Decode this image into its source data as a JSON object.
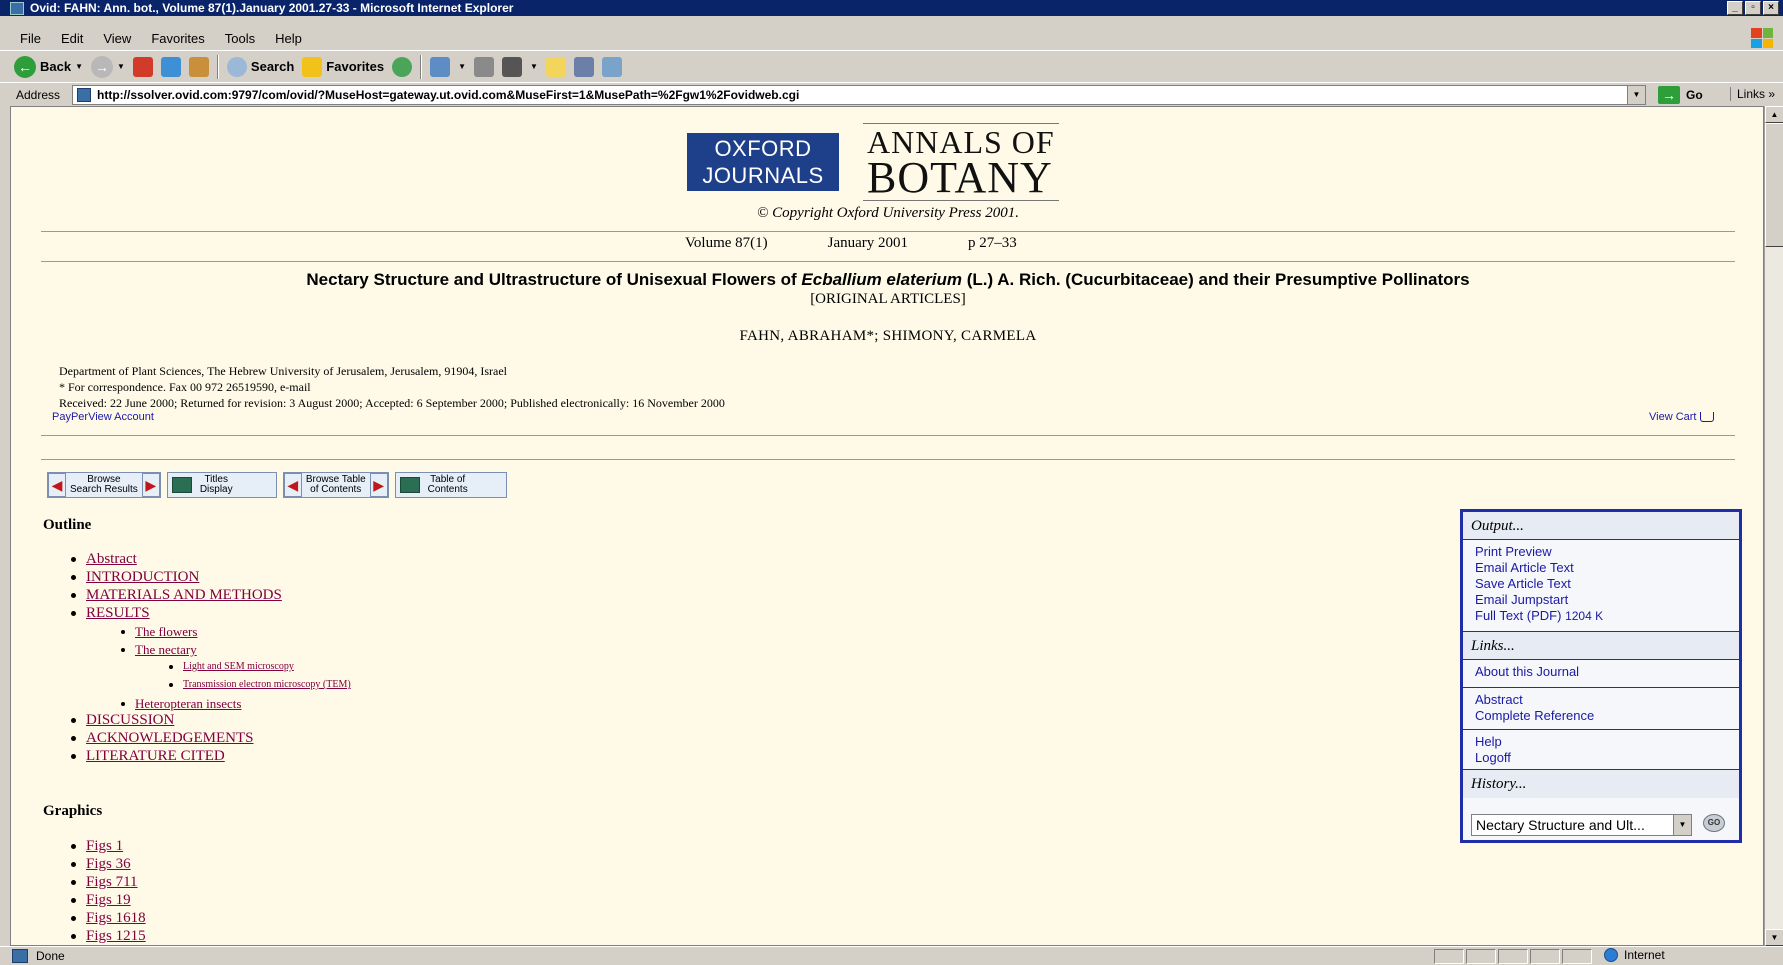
{
  "window": {
    "title": "Ovid: FAHN: Ann. bot., Volume 87(1).January 2001.27-33 - Microsoft Internet Explorer",
    "controls": [
      "_",
      "▫",
      "×"
    ]
  },
  "menu": {
    "items": [
      "File",
      "Edit",
      "View",
      "Favorites",
      "Tools",
      "Help"
    ]
  },
  "toolbar": {
    "back_label": "Back",
    "search_label": "Search",
    "favorites_label": "Favorites"
  },
  "address": {
    "label": "Address",
    "url": "http://ssolver.ovid.com:9797/com/ovid/?MuseHost=gateway.ut.ovid.com&MuseFirst=1&MusePath=%2Fgw1%2Fovidweb.cgi",
    "go_label": "Go",
    "links_label": "Links"
  },
  "masthead": {
    "oxford_line1": "OXFORD",
    "oxford_line2": "JOURNALS",
    "annals_line1": "ANNALS OF",
    "annals_line2": "BOTANY",
    "copyright": "© Copyright Oxford University Press 2001."
  },
  "citation": {
    "volume": "Volume 87(1)",
    "date": "January 2001",
    "pages": "p 27–33"
  },
  "article": {
    "title_part1": "Nectary Structure and Ultrastructure of Unisexual Flowers of ",
    "title_italic": "Ecballium elaterium",
    "title_part2": " (L.) A. Rich. (Cucurbitaceae) and their Presumptive Pollinators",
    "type": "[ORIGINAL ARTICLES]",
    "authors": "FAHN, ABRAHAM*; SHIMONY, CARMELA",
    "affiliation": "Department of Plant Sciences, The Hebrew University of Jerusalem, Jerusalem, 91904, Israel",
    "correspondence": "* For correspondence. Fax 00 972 26519590, e-mail",
    "dates": "Received: 22 June 2000; Returned for revision: 3 August 2000; Accepted: 6 September 2000; Published electronically: 16 November 2000"
  },
  "links_row": {
    "ppv": "PayPerView Account",
    "view_cart": "View Cart"
  },
  "nav_buttons": {
    "browse_results_l1": "Browse",
    "browse_results_l2": "Search Results",
    "titles_l1": "Titles",
    "titles_l2": "Display",
    "browse_toc_l1": "Browse Table",
    "browse_toc_l2": "of Contents",
    "toc_l1": "Table of",
    "toc_l2": "Contents"
  },
  "outline": {
    "heading": "Outline",
    "items": [
      {
        "label": "Abstract",
        "level": 1
      },
      {
        "label": "INTRODUCTION",
        "level": 1
      },
      {
        "label": "MATERIALS AND METHODS",
        "level": 1
      },
      {
        "label": "RESULTS",
        "level": 1
      },
      {
        "label": "The flowers",
        "level": 2
      },
      {
        "label": "The nectary",
        "level": 2
      },
      {
        "label": "Light and SEM microscopy",
        "level": 3
      },
      {
        "label": "Transmission electron microscopy (TEM)",
        "level": 3
      },
      {
        "label": "Heteropteran insects",
        "level": 2
      },
      {
        "label": "DISCUSSION",
        "level": 1
      },
      {
        "label": "ACKNOWLEDGEMENTS",
        "level": 1
      },
      {
        "label": "LITERATURE CITED",
        "level": 1
      }
    ]
  },
  "graphics": {
    "heading": "Graphics",
    "items": [
      "Figs 1",
      "Figs 36",
      "Figs 711",
      "Figs 19",
      "Figs 1618",
      "Figs 1215"
    ]
  },
  "panel": {
    "output_head": "Output...",
    "output_links": [
      "Print Preview",
      "Email Article Text",
      "Save Article Text",
      "Email Jumpstart",
      "Full Text (PDF)"
    ],
    "pdf_size": "1204 K",
    "links_head": "Links...",
    "about_journal": "About this Journal",
    "abstract_link": "Abstract",
    "complete_ref": "Complete Reference",
    "help": "Help",
    "logoff": "Logoff",
    "history_head": "History...",
    "history_value": "Nectary Structure and Ult...",
    "go_small": "GO"
  },
  "status": {
    "text": "Done",
    "zone": "Internet"
  },
  "colors": {
    "page_bg": "#fffae8",
    "link_outline": "#800040",
    "link_panel": "#1a1aa6",
    "panel_border": "#1f2ea8",
    "titlebar": "#0a246a"
  }
}
